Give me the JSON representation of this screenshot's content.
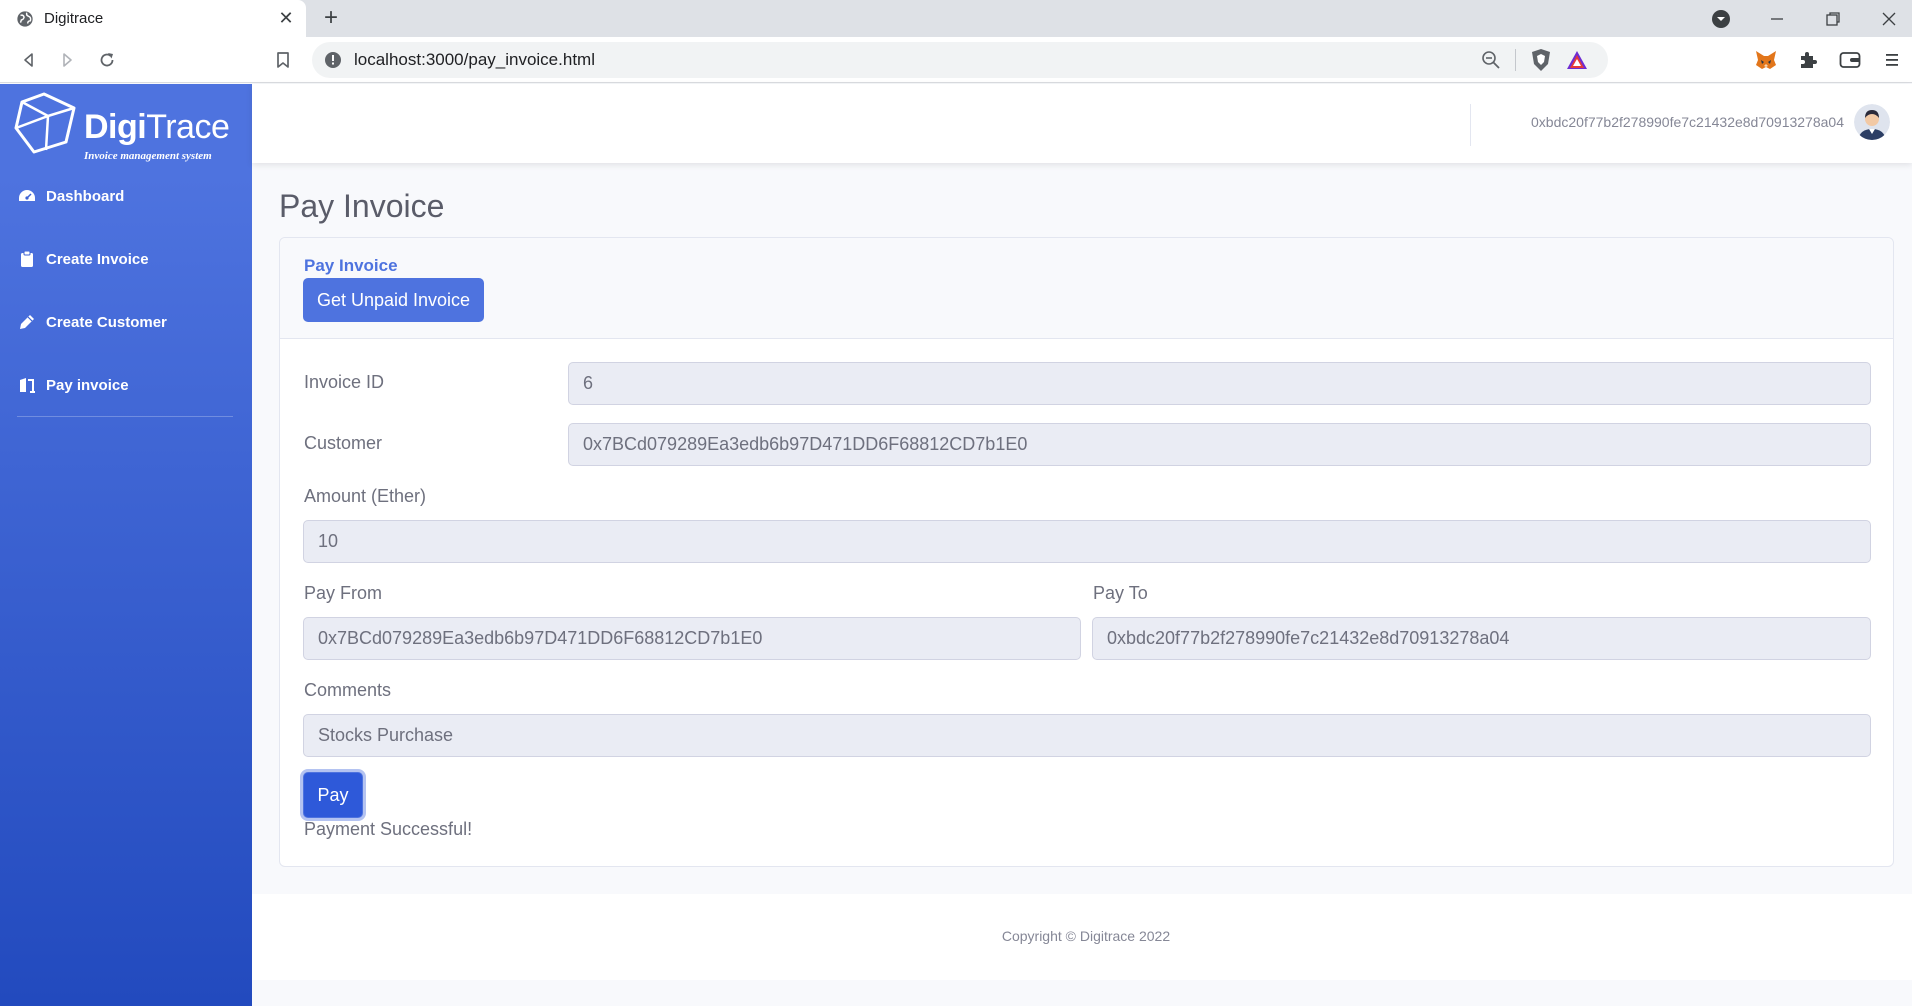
{
  "browser": {
    "tab_title": "Digitrace",
    "tab_close": "✕",
    "new_tab": "+",
    "url": "localhost:3000/pay_invoice.html"
  },
  "brand": {
    "name_bold": "Digi",
    "name_light": "Trace",
    "subtitle": "Invoice management system"
  },
  "sidebar": {
    "items": [
      {
        "label": "Dashboard",
        "icon": "dashboard-icon"
      },
      {
        "label": "Create Invoice",
        "icon": "clipboard-icon"
      },
      {
        "label": "Create Customer",
        "icon": "pen-icon"
      },
      {
        "label": "Pay invoice",
        "icon": "pay-icon"
      }
    ]
  },
  "topbar": {
    "account": "0xbdc20f77b2f278990fe7c21432e8d70913278a04"
  },
  "page": {
    "title": "Pay Invoice"
  },
  "card": {
    "header_title": "Pay Invoice",
    "get_unpaid_label": "Get Unpaid Invoice",
    "invoice_id_label": "Invoice ID",
    "invoice_id_value": "6",
    "customer_label": "Customer",
    "customer_value": "0x7BCd079289Ea3edb6b97D471DD6F68812CD7b1E0",
    "amount_label": "Amount (Ether)",
    "amount_value": "10",
    "pay_from_label": "Pay From",
    "pay_from_value": "0x7BCd079289Ea3edb6b97D471DD6F68812CD7b1E0",
    "pay_to_label": "Pay To",
    "pay_to_value": "0xbdc20f77b2f278990fe7c21432e8d70913278a04",
    "comments_label": "Comments",
    "comments_value": "Stocks Purchase",
    "pay_label": "Pay",
    "status": "Payment Successful!"
  },
  "footer": {
    "copyright": "Copyright © Digitrace 2022"
  },
  "colors": {
    "primary": "#4e73df",
    "primary_dark": "#224abe",
    "text": "#5a5c69",
    "muted": "#858796"
  }
}
